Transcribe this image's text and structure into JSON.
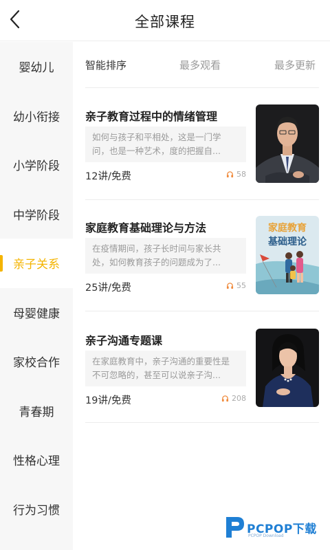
{
  "header": {
    "title": "全部课程",
    "back_icon": "chevron-left-icon"
  },
  "sidebar": {
    "active_color": "#f4b400",
    "items": [
      {
        "label": "婴幼儿",
        "active": false
      },
      {
        "label": "幼小衔接",
        "active": false
      },
      {
        "label": "小学阶段",
        "active": false
      },
      {
        "label": "中学阶段",
        "active": false
      },
      {
        "label": "亲子关系",
        "active": true
      },
      {
        "label": "母婴健康",
        "active": false
      },
      {
        "label": "家校合作",
        "active": false
      },
      {
        "label": "青春期",
        "active": false
      },
      {
        "label": "性格心理",
        "active": false
      },
      {
        "label": "行为习惯",
        "active": false
      }
    ]
  },
  "sort": {
    "options": [
      {
        "label": "智能排序",
        "selected": true
      },
      {
        "label": "最多观看",
        "selected": false
      },
      {
        "label": "最多更新",
        "selected": false
      }
    ]
  },
  "courses": [
    {
      "title": "亲子教育过程中的情绪管理",
      "desc_line1": "如何与孩子和平相处，这是一门学",
      "desc_line2": "问，也是一种艺术，度的把握自...",
      "meta": "12讲/免费",
      "count": "58",
      "count_icon": "headphones-icon",
      "thumb": "man-in-suit-photo"
    },
    {
      "title": "家庭教育基础理论与方法",
      "desc_line1": "在疫情期间，孩子长时间与家长共",
      "desc_line2": "处，如何教育孩子的问题成为了...",
      "meta": "25讲/免费",
      "count": "55",
      "count_icon": "headphones-icon",
      "thumb": "family-illustration",
      "thumb_line1": "家庭教育",
      "thumb_line2": "基础理论"
    },
    {
      "title": "亲子沟通专题课",
      "desc_line1": "在家庭教育中，亲子沟通的重要性是",
      "desc_line2": "不可忽略的，甚至可以说亲子沟...",
      "meta": "19讲/免费",
      "count": "208",
      "count_icon": "headphones-icon",
      "thumb": "woman-portrait-photo"
    }
  ],
  "watermark": {
    "brand": "PCPOP下载",
    "sub": "PCPOP Download"
  }
}
